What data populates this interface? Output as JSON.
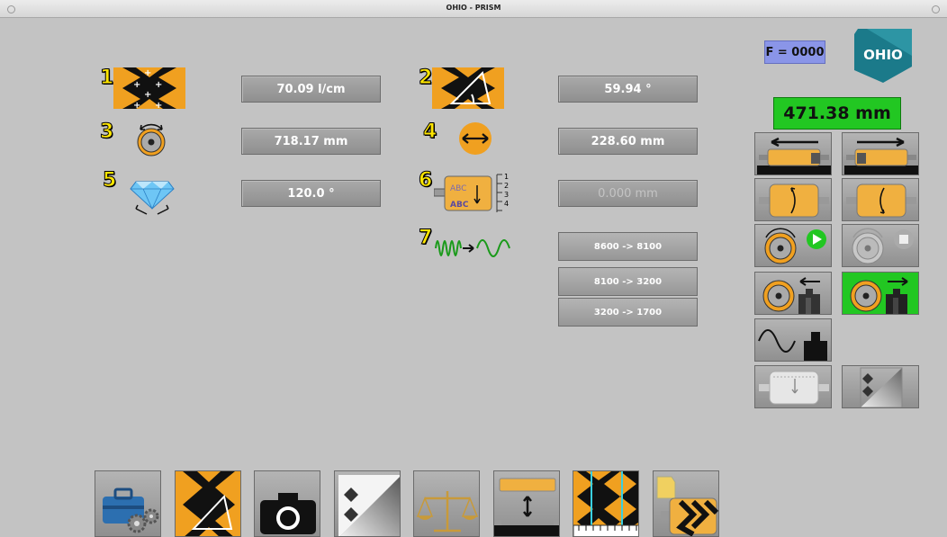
{
  "window": {
    "title": "OHIO - PRISM"
  },
  "logo": {
    "text": "OHIO"
  },
  "status": {
    "f_value": "F = 0000",
    "measurement": "471.38 mm"
  },
  "params": [
    {
      "num": "1",
      "icon": "cell-pattern-icon",
      "value": "70.09 l/cm",
      "enabled": true
    },
    {
      "num": "2",
      "icon": "cell-angle-icon",
      "value": "59.94 °",
      "enabled": true
    },
    {
      "num": "3",
      "icon": "roller-rotation-icon",
      "value": "718.17 mm",
      "enabled": true
    },
    {
      "num": "4",
      "icon": "width-arrows-icon",
      "value": "228.60 mm",
      "enabled": true
    },
    {
      "num": "5",
      "icon": "diamond-stylus-icon",
      "value": "120.0 °",
      "enabled": true
    },
    {
      "num": "6",
      "icon": "text-offset-icon",
      "value": "0.000 mm",
      "enabled": false
    },
    {
      "num": "7",
      "icon": "frequency-convert-icon",
      "value": "",
      "enabled": true
    }
  ],
  "roll_icon_labels": {
    "abc_top": "ABC",
    "abc_bottom": "ABC",
    "ticks": [
      "1",
      "2",
      "3",
      "4"
    ]
  },
  "frequency_buttons": [
    "8600 -> 8100",
    "8100 -> 3200",
    "3200 -> 1700"
  ],
  "colors": {
    "accent_orange": "#f0a020",
    "active_green": "#22c722",
    "value_box": "#9a9a9a",
    "measure_green": "#22c722"
  }
}
